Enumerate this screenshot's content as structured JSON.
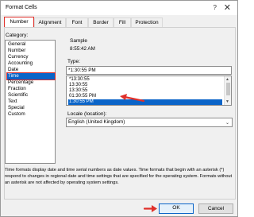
{
  "window": {
    "title": "Format Cells",
    "help": "?",
    "close": "✕"
  },
  "tabs": [
    {
      "label": "Number"
    },
    {
      "label": "Alignment"
    },
    {
      "label": "Font"
    },
    {
      "label": "Border"
    },
    {
      "label": "Fill"
    },
    {
      "label": "Protection"
    }
  ],
  "category": {
    "label": "Category:",
    "items": [
      "General",
      "Number",
      "Currency",
      "Accounting",
      "Date",
      "Time",
      "Percentage",
      "Fraction",
      "Scientific",
      "Text",
      "Special",
      "Custom"
    ],
    "selected": "Time"
  },
  "sample": {
    "label": "Sample",
    "value": "8:55:42 AM"
  },
  "type": {
    "label": "Type:",
    "input_value": "*1:30:55 PM",
    "items": [
      "*13:30:55",
      "13:30:55",
      "13:30:55",
      "01:30:55 PM",
      "1:30:55 PM"
    ],
    "selected": "1:30:55 PM"
  },
  "locale": {
    "label": "Locale (location):",
    "value": "English (United Kingdom)"
  },
  "description": "Time formats display date and time serial numbers as date values. Time formats that begin with an asterisk (*) respond to changes in regional date and time settings that are specified for the operating system. Formats without an asterisk are not affected by operating system settings.",
  "buttons": {
    "ok": "OK",
    "cancel": "Cancel"
  },
  "colors": {
    "accent": "#0a64c8",
    "annotation": "#e0302a"
  },
  "icons": {
    "arrow": "red-arrow-icon",
    "caret": "chevron-down-icon"
  }
}
